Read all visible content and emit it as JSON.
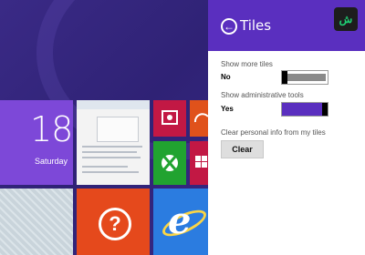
{
  "start_screen": {
    "calendar": {
      "day": "18",
      "weekday": "Saturday"
    },
    "help_tile": {
      "glyph": "?"
    }
  },
  "tiles_panel": {
    "title": "Tiles",
    "back_glyph": "←",
    "logo_glyph": "ش",
    "show_more_tiles": {
      "label": "Show more tiles",
      "value": "No",
      "on": false
    },
    "show_admin_tools": {
      "label": "Show administrative tools",
      "value": "Yes",
      "on": true
    },
    "clear_personal_info": {
      "label": "Clear personal info from my tiles",
      "button_label": "Clear"
    }
  },
  "colors": {
    "panel_header": "#5a2fbf",
    "toggle_on": "#5a2fbf",
    "calendar_tile": "#7d48d8",
    "ie_tile": "#2b7ce0",
    "help_tile": "#e5491c"
  }
}
